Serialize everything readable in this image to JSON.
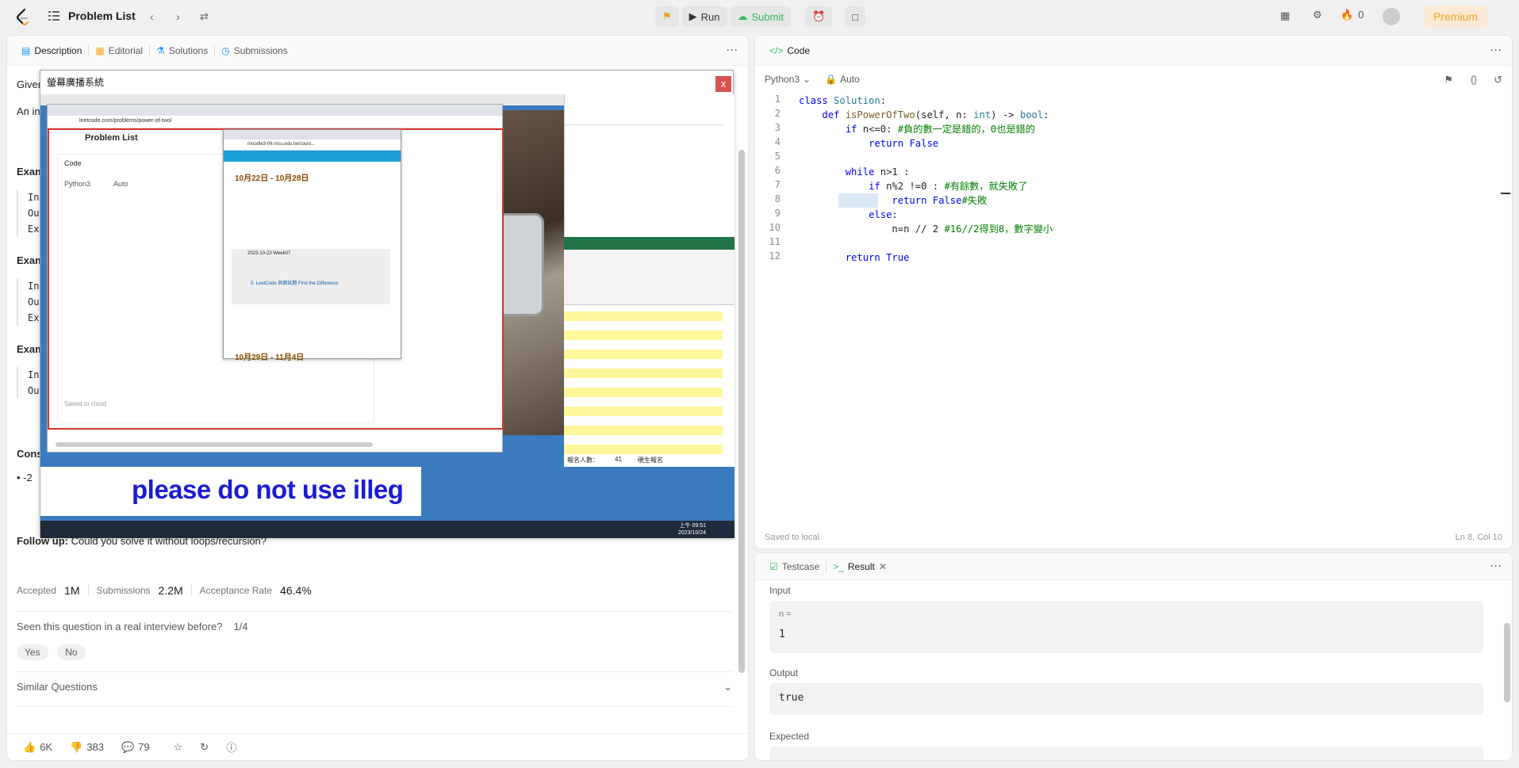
{
  "topbar": {
    "title": "Problem List",
    "run_label": "Run",
    "submit_label": "Submit",
    "streak_count": "0",
    "premium_label": "Premium"
  },
  "description_panel": {
    "tabs": [
      "Description",
      "Editorial",
      "Solutions",
      "Submissions"
    ],
    "fragments": {
      "giv": "Giver",
      "an": "An in",
      "exa1": "Exam",
      "i1": "In",
      "o1": "Ou",
      "e1": "Ex",
      "exa2": "Exam",
      "i2": "In",
      "o2": "Ou",
      "e2": "Ex",
      "exa3": "Exam",
      "i3": "In",
      "o3": "Ou",
      "cons": "Cons",
      "bullet": "• -2"
    },
    "follow_up_label": "Follow up:",
    "follow_up_text": "Could you solve it without loops/recursion?",
    "stats": {
      "accepted_label": "Accepted",
      "accepted_value": "1M",
      "submissions_label": "Submissions",
      "submissions_value": "2.2M",
      "rate_label": "Acceptance Rate",
      "rate_value": "46.4%"
    },
    "interview_question": "Seen this question in a real interview before?",
    "interview_count": "1/4",
    "yes_label": "Yes",
    "no_label": "No",
    "similar_questions": "Similar Questions",
    "footer": {
      "likes": "6K",
      "dislikes": "383",
      "comments": "79"
    }
  },
  "overlay": {
    "title": "螢幕廣播系統",
    "close": "x",
    "subtitle": "please do not use illeg",
    "inner_title": "Problem List",
    "inner_code_tab": "Code",
    "inner_lang": "Python3",
    "inner_auto": "Auto",
    "inner_saved": "Saved to cloud",
    "inner_url": "leetcode.com/problems/power-of-two/",
    "moodle_url": "moodle3-06.mcu.edu.tw/cours...",
    "moodle_week1": "10月22日 - 10月28日",
    "moodle_week2": "10月29日 - 11月4日",
    "moodle_item": "2023-10-23 Week07",
    "moodle_sub": "5. LeetCode 與面試題 Find the Difference",
    "excel_total": "報名人數：",
    "excel_total_value": "41",
    "excel_footer": "覗生報名",
    "clock": "上午 09:51",
    "date": "2023/10/24"
  },
  "code_panel": {
    "tab_label": "Code",
    "language": "Python3",
    "auto_label": "Auto",
    "lines": [
      {
        "n": "1",
        "text": "class Solution:"
      },
      {
        "n": "2",
        "text": "    def isPowerOfTwo(self, n: int) -> bool:"
      },
      {
        "n": "3",
        "text": "        if n<=0: #負的數一定是錯的，0也是錯的"
      },
      {
        "n": "4",
        "text": "            return False"
      },
      {
        "n": "5",
        "text": ""
      },
      {
        "n": "6",
        "text": "        while n>1 :"
      },
      {
        "n": "7",
        "text": "            if n%2 !=0 : #有餘數，就失敗了"
      },
      {
        "n": "8",
        "text": "                return False#失敗"
      },
      {
        "n": "9",
        "text": "            else:"
      },
      {
        "n": "10",
        "text": "                n=n // 2 #16//2得8，數字變小"
      },
      {
        "n": "11",
        "text": ""
      },
      {
        "n": "12",
        "text": "        return True"
      }
    ],
    "saved_label": "Saved to local",
    "cursor_pos": "Ln 8, Col 10"
  },
  "result_panel": {
    "testcase_tab": "Testcase",
    "result_tab": "Result",
    "input_label": "Input",
    "input_var": "n =",
    "input_value": "1",
    "output_label": "Output",
    "output_value": "true",
    "expected_label": "Expected"
  }
}
